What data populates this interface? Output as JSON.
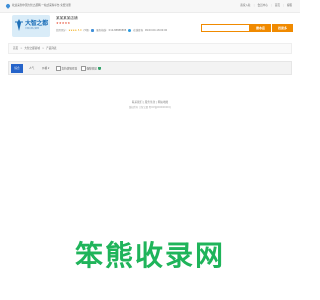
{
  "topbar": {
    "welcome": "欢迎来到中国大智之都网,一站式采购平台,免费注册",
    "links": [
      "商家入驻",
      "会员中心",
      "首页",
      "客服"
    ]
  },
  "shop": {
    "logo_text": "大智之都",
    "logo_sub": "中国大智之都网",
    "name": "某某某某店铺",
    "stars": "★★★★★",
    "credit_label": "信用评分:",
    "rating": "★★★★ 5.0",
    "reviews": "(5条)",
    "phone_label": "服务热线:",
    "phone": "010-88888888",
    "qq_label": "在线咨询",
    "hours": "09:00:00-18:00:00"
  },
  "search": {
    "placeholder": "",
    "store_button": "搜本店",
    "global_button": "找更多"
  },
  "breadcrumb": {
    "home": "首页",
    "shop": "大智之都商城",
    "current": "产品列表"
  },
  "filters": {
    "default": "综合",
    "popularity": "人气",
    "price": "价格 ▾",
    "option1": "支持货到付款",
    "option2": "保障交易"
  },
  "footer": {
    "line1": "联系我们 | 服务条款 | 网站地图",
    "line2": "版权所有 大智之都 粤ICP备00000000号"
  },
  "watermark": "笨熊收录网"
}
